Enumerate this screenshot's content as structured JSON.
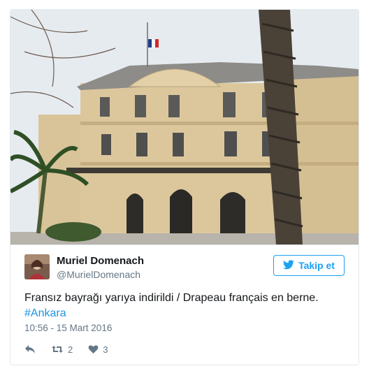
{
  "tweet": {
    "author_name": "Muriel Domenach",
    "author_handle": "@MurielDomenach",
    "follow_label": "Takip et",
    "text": "Fransız bayrağı yarıya indirildi / Drapeau français en berne.",
    "hashtag": "#Ankara",
    "timestamp": "10:56 - 15 Mart 2016",
    "retweet_count": "2",
    "like_count": "3"
  },
  "icons": {
    "follow": "twitter-bird-icon",
    "reply": "reply-icon",
    "retweet": "retweet-icon",
    "like": "heart-icon"
  },
  "colors": {
    "accent": "#1da1f2",
    "hashtag": "#1b95e0",
    "muted": "#657786",
    "border": "#e1e8ed"
  }
}
